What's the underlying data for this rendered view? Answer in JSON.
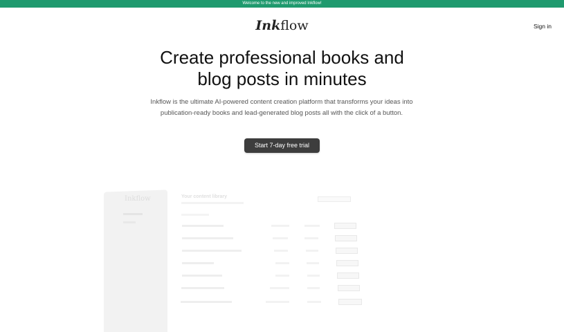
{
  "announcement": "Welcome to the new and improved Inkflow!",
  "brand": {
    "part_italic": "Ink",
    "part_regular": "flow"
  },
  "header": {
    "signin_label": "Sign in"
  },
  "hero": {
    "title_line1": "Create professional books and",
    "title_line2": "blog posts in minutes",
    "subtitle": "Inkflow is the ultimate AI-powered content creation platform that transforms your ideas into publication-ready books and lead-generated blog posts all with the click of a button.",
    "cta_label": "Start 7-day free trial"
  },
  "preview": {
    "logo": "Inkflow",
    "heading": "Your content library",
    "colors": {
      "cta": "#3d3d3d",
      "announcement_bg": "#1f9a6e"
    }
  }
}
